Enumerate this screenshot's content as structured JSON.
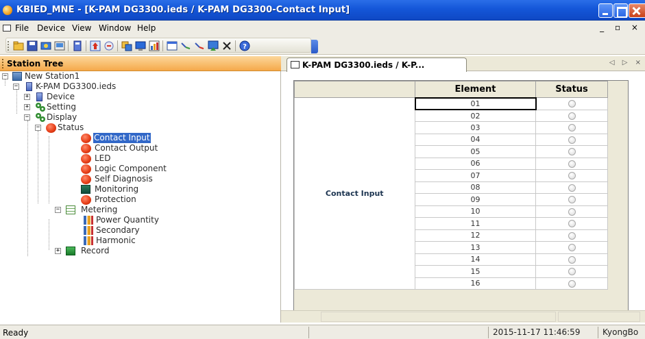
{
  "window": {
    "title": "KBIED_MNE - [K-PAM DG3300.ieds / K-PAM DG3300-Contact Input]"
  },
  "menu": {
    "items": [
      {
        "label": "File",
        "accel": "F"
      },
      {
        "label": "Device",
        "accel": "D"
      },
      {
        "label": "View",
        "accel": "V"
      },
      {
        "label": "Window",
        "accel": "W"
      },
      {
        "label": "Help",
        "accel": "H"
      }
    ],
    "mdi_controls": "_ ▫ ×"
  },
  "toolbar": {
    "icons": [
      "new-icon",
      "save-icon",
      "open-icon",
      "connect-icon",
      "ied-icon",
      "upload-icon",
      "download-icon",
      "settings-icon",
      "monitor-icon",
      "chart-icon",
      "table-icon",
      "link-icon",
      "unlink-icon",
      "export-icon",
      "delete-icon",
      "help-icon"
    ]
  },
  "tree": {
    "header": "Station Tree",
    "nodes": [
      {
        "label": "New Station1",
        "icon": "station-icon",
        "expander": "−"
      },
      {
        "label": "K-PAM DG3300.ieds",
        "icon": "ied-icon",
        "expander": "−"
      },
      {
        "label": "Device",
        "icon": "device-icon",
        "expander": "+"
      },
      {
        "label": "Setting",
        "icon": "gear-icon",
        "expander": "+"
      },
      {
        "label": "Display",
        "icon": "gear-icon",
        "expander": "−"
      },
      {
        "label": "Status",
        "icon": "red-ball-icon",
        "expander": "−"
      },
      {
        "label": "Contact Input",
        "icon": "red-ball-icon",
        "selected": true
      },
      {
        "label": "Contact Output",
        "icon": "red-ball-icon"
      },
      {
        "label": "LED",
        "icon": "red-ball-icon"
      },
      {
        "label": "Logic Component",
        "icon": "red-ball-icon"
      },
      {
        "label": "Self Diagnosis",
        "icon": "red-ball-icon"
      },
      {
        "label": "Monitoring",
        "icon": "monitor-icon"
      },
      {
        "label": "Protection",
        "icon": "red-ball-icon"
      },
      {
        "label": "Metering",
        "icon": "table-icon",
        "expander": "−"
      },
      {
        "label": "Power Quantity",
        "icon": "bar-chart-icon"
      },
      {
        "label": "Secondary",
        "icon": "bar-chart-icon"
      },
      {
        "label": "Harmonic",
        "icon": "bar-chart-icon"
      },
      {
        "label": "Record",
        "icon": "record-icon",
        "expander": "+"
      }
    ]
  },
  "document": {
    "tab_label": "K-PAM DG3300.ieds / K-P...",
    "tab_nav": "◁ ▷ ×",
    "grid": {
      "headers": {
        "element": "Element",
        "status": "Status"
      },
      "group_label": "Contact Input",
      "rows": [
        "01",
        "02",
        "03",
        "04",
        "05",
        "06",
        "07",
        "08",
        "09",
        "10",
        "11",
        "12",
        "13",
        "14",
        "15",
        "16"
      ]
    }
  },
  "statusbar": {
    "ready": "Ready",
    "datetime": "2015-11-17 11:46:59",
    "user": "KyongBo"
  },
  "colors": {
    "title_bar": "#1456d8",
    "tree_header": "#f5a94a",
    "selection": "#3268c8",
    "status_ball": "#e8401a"
  }
}
